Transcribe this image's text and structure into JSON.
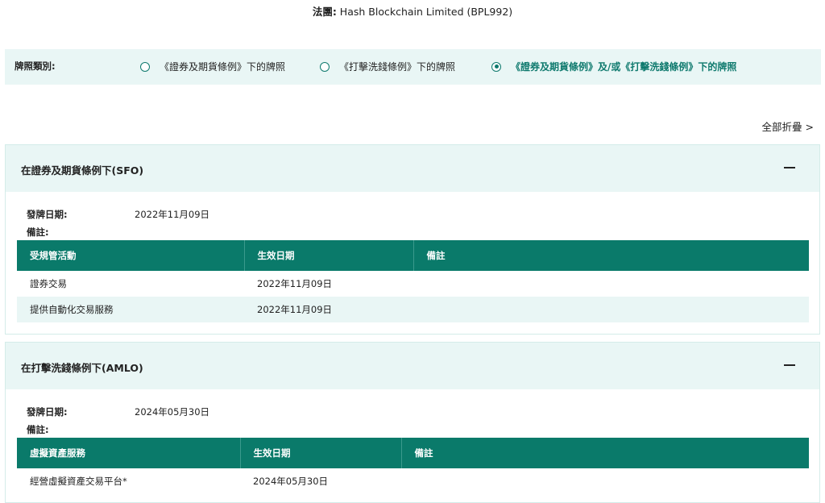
{
  "corporation": {
    "label": "法團:",
    "value": "Hash Blockchain Limited (BPL992)"
  },
  "license_type": {
    "label": "牌照類別:",
    "options": [
      {
        "label": "《證券及期貨條例》下的牌照",
        "checked": false
      },
      {
        "label": "《打擊洗錢條例》下的牌照",
        "checked": false
      },
      {
        "label": "《證券及期貨條例》及/或《打擊洗錢條例》下的牌照",
        "checked": true
      }
    ]
  },
  "collapse_all_label": "全部折疊 >",
  "sections": [
    {
      "title": "在證券及期貨條例下(SFO)",
      "issue_date_label": "發牌日期:",
      "issue_date": "2022年11月09日",
      "remarks_label": "備註:",
      "columns": [
        "受規管活動",
        "生效日期",
        "備註"
      ],
      "rows": [
        [
          "證券交易",
          "2022年11月09日",
          ""
        ],
        [
          "提供自動化交易服務",
          "2022年11月09日",
          ""
        ]
      ]
    },
    {
      "title": "在打擊洗錢條例下(AMLO)",
      "issue_date_label": "發牌日期:",
      "issue_date": "2024年05月30日",
      "remarks_label": "備註:",
      "columns": [
        "虛擬資產服務",
        "生效日期",
        "備註"
      ],
      "rows": [
        [
          "經營虛擬資產交易平台*",
          "2024年05月30日",
          ""
        ]
      ]
    }
  ],
  "colors": {
    "accent": "#0a7a6a",
    "light": "#e9f6f5"
  }
}
